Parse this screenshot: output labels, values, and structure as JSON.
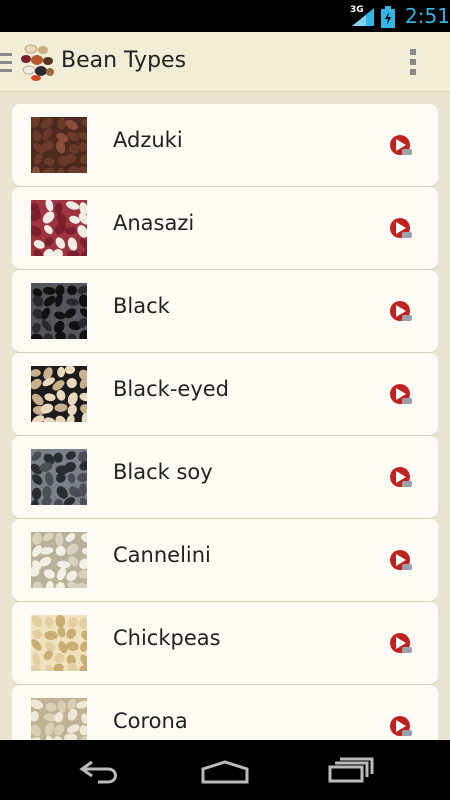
{
  "status_bar": {
    "network": "3G",
    "time": "2:51"
  },
  "action_bar": {
    "title": "Bean Types"
  },
  "beans": [
    {
      "name": "Adzuki",
      "colors": [
        "#6b3a2a",
        "#8a4e38",
        "#4d2a1e"
      ]
    },
    {
      "name": "Anasazi",
      "colors": [
        "#7a1f2b",
        "#f1ece4",
        "#a03340"
      ]
    },
    {
      "name": "Black",
      "colors": [
        "#111111",
        "#2a2a2e",
        "#55565c"
      ]
    },
    {
      "name": "Black-eyed",
      "colors": [
        "#e9d9bd",
        "#c9b08d",
        "#1c1c1c"
      ]
    },
    {
      "name": "Black soy",
      "colors": [
        "#2a2c30",
        "#4b4e55",
        "#7b7f86"
      ]
    },
    {
      "name": "Cannelini",
      "colors": [
        "#f2efe4",
        "#d8d1bd",
        "#b9b19a"
      ]
    },
    {
      "name": "Chickpeas",
      "colors": [
        "#e2cfa2",
        "#c9ae74",
        "#f0e2bf"
      ]
    },
    {
      "name": "Corona",
      "colors": [
        "#efe8d6",
        "#d9cfb5",
        "#bfb394"
      ]
    }
  ],
  "colors": {
    "action_bar": "#f2edd7",
    "background": "#e9e5d0",
    "card": "#fdfbf4",
    "accent": "#33b5e5",
    "play": "#c0231f"
  },
  "icons": {
    "drawer": "drawer-icon",
    "app": "beans-app-icon",
    "overflow": "overflow-menu-icon",
    "play": "play-icon",
    "back": "back-icon",
    "home": "home-icon",
    "recents": "recents-icon"
  }
}
